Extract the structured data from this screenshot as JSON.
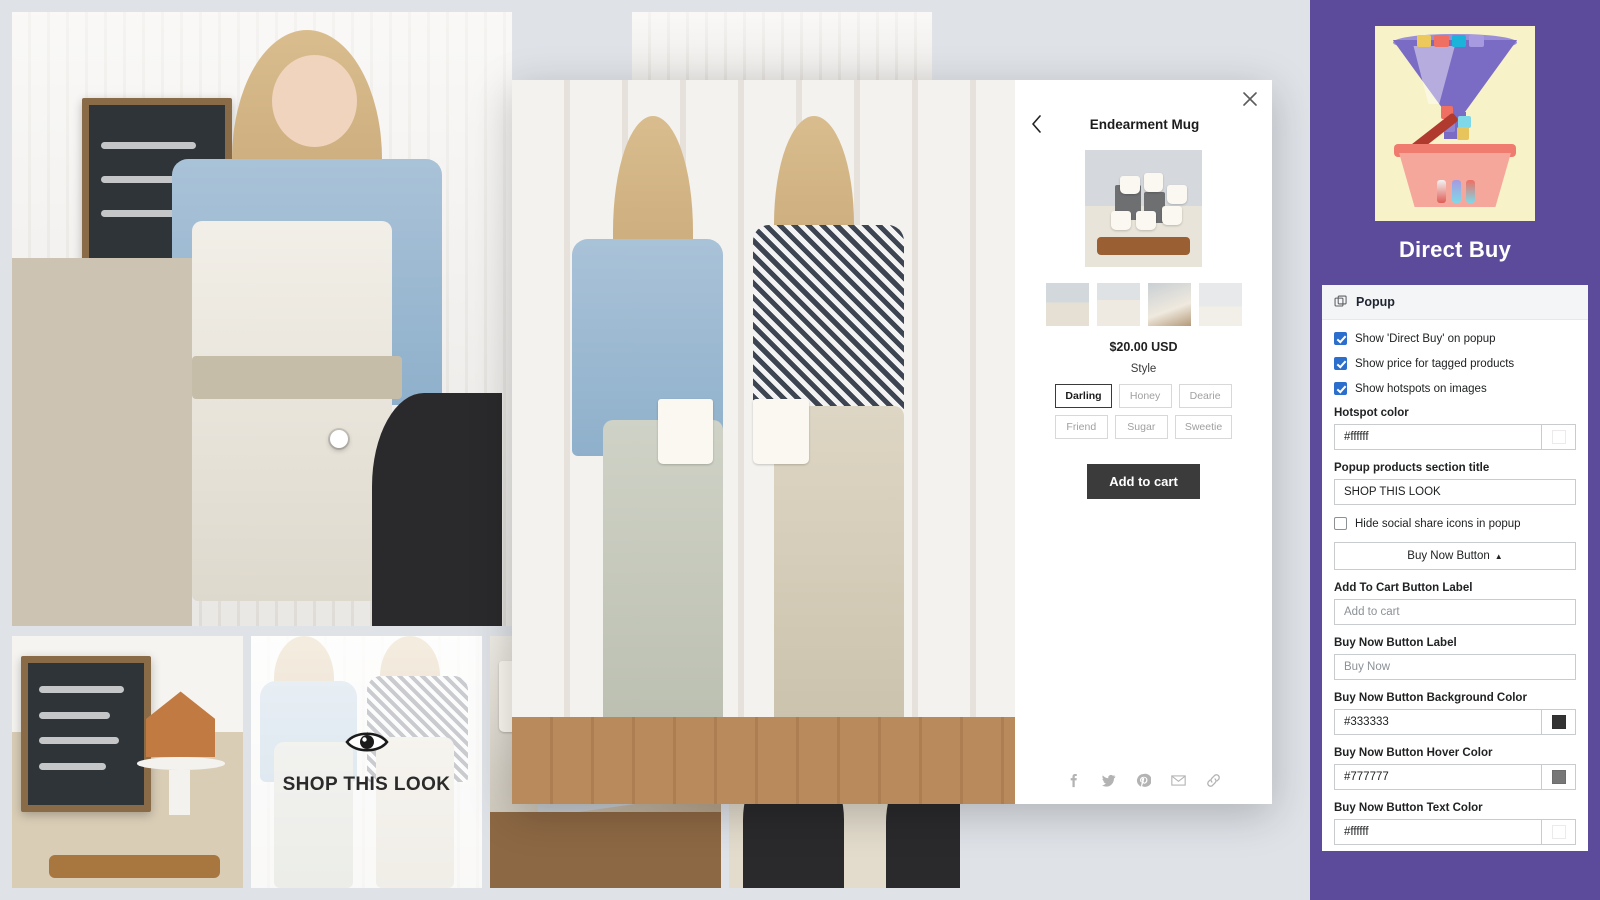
{
  "app": {
    "name": "Direct Buy",
    "logo_icon": "funnel-basket-icon"
  },
  "settings": {
    "section_title": "Popup",
    "section_icon": "duplicate-icon",
    "checkboxes": [
      {
        "label": "Show 'Direct Buy' on popup",
        "checked": true
      },
      {
        "label": "Show price for tagged products",
        "checked": true
      },
      {
        "label": "Show hotspots on images",
        "checked": true
      }
    ],
    "hotspot_color": {
      "label": "Hotspot color",
      "value": "#ffffff",
      "swatch": "#ffffff"
    },
    "popup_section_title": {
      "label": "Popup products section title",
      "value": "SHOP THIS LOOK"
    },
    "hide_social": {
      "label": "Hide social share icons in popup",
      "checked": false
    },
    "collapse_button": {
      "label": "Buy Now Button",
      "caret": "▲"
    },
    "add_to_cart_label": {
      "label": "Add To Cart Button Label",
      "placeholder": "Add to cart",
      "value": ""
    },
    "buy_now_label": {
      "label": "Buy Now Button Label",
      "placeholder": "Buy Now",
      "value": ""
    },
    "buy_now_bg": {
      "label": "Buy Now Button Background Color",
      "value": "#333333",
      "swatch": "#333333"
    },
    "buy_now_hover": {
      "label": "Buy Now Button Hover Color",
      "value": "#777777",
      "swatch": "#777777"
    },
    "buy_now_text": {
      "label": "Buy Now Button Text Color",
      "value": "#ffffff",
      "swatch": "#ffffff"
    }
  },
  "popup": {
    "close_icon": "close-icon",
    "back_icon": "chevron-left-icon",
    "product_title": "Endearment Mug",
    "price": "$20.00 USD",
    "option_label": "Style",
    "variants": [
      {
        "label": "Darling",
        "selected": true
      },
      {
        "label": "Honey",
        "selected": false
      },
      {
        "label": "Dearie",
        "selected": false
      },
      {
        "label": "Friend",
        "selected": false
      },
      {
        "label": "Sugar",
        "selected": false
      },
      {
        "label": "Sweetie",
        "selected": false
      }
    ],
    "add_to_cart": "Add to cart",
    "share_icons": [
      "facebook-icon",
      "twitter-icon",
      "pinterest-icon",
      "email-icon",
      "link-icon"
    ],
    "thumbnails": [
      "thumbnail-1",
      "thumbnail-2",
      "thumbnail-3",
      "thumbnail-4"
    ]
  },
  "gallery": {
    "shop_overlay_label": "SHOP THIS LOOK",
    "overlay_icon": "eye-icon",
    "tiles": [
      "gallery-tile-hero",
      "gallery-tile-gingerbread",
      "gallery-tile-aprons",
      "gallery-tile-towels",
      "gallery-tile-chairs"
    ]
  },
  "colors": {
    "sidebar_bg": "#5c4b9b",
    "accent_blue": "#2c6ecb",
    "page_bg": "#dfe3e8"
  }
}
